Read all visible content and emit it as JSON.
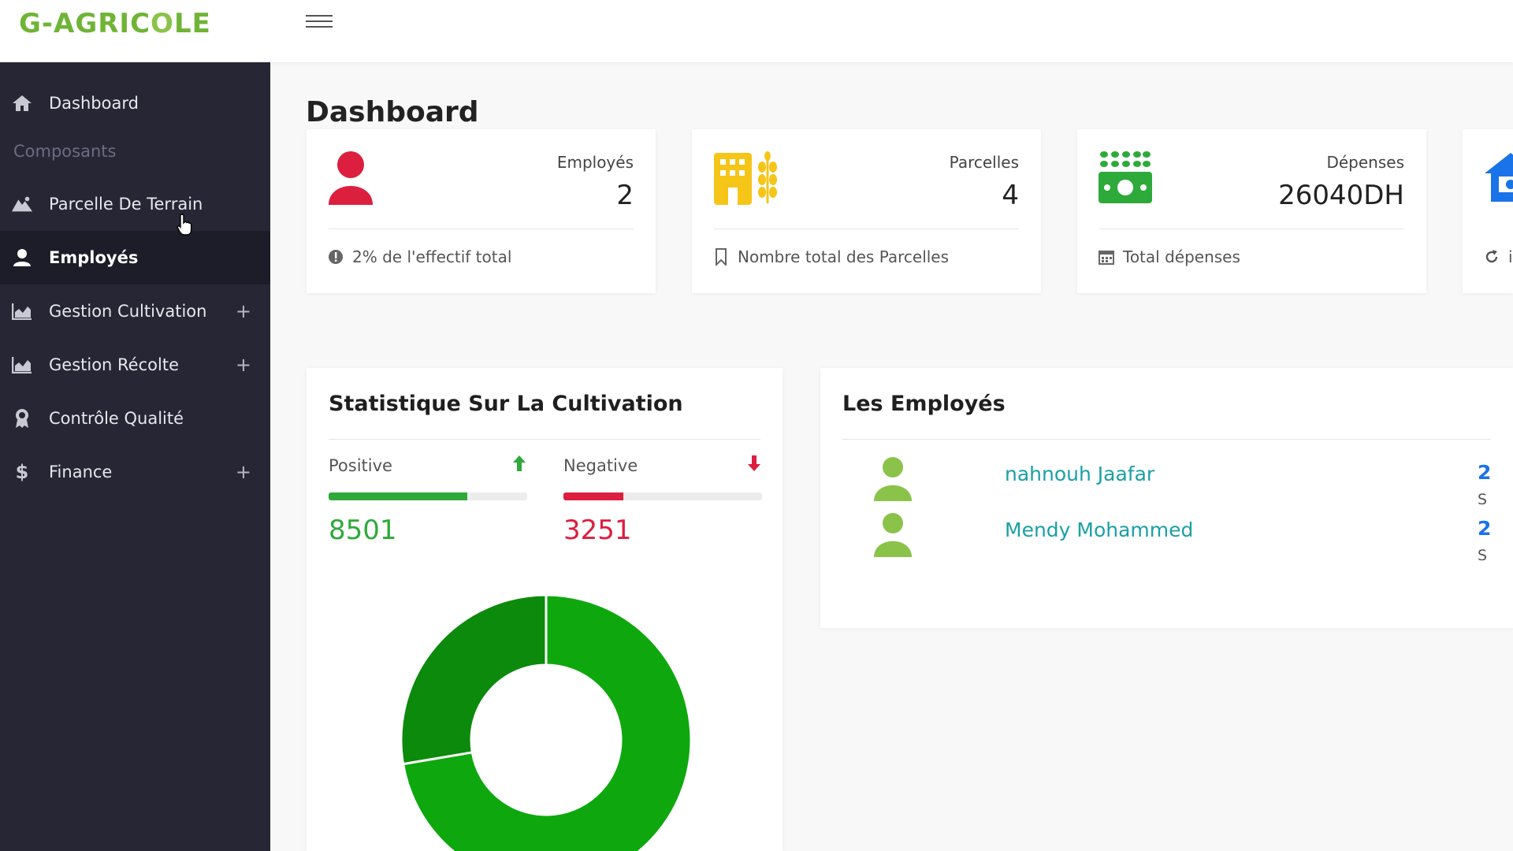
{
  "app": {
    "logo": "G-AGRICOLE",
    "logo_prefix": "G-AGRIC",
    "logo_leaf": "O",
    "logo_suffix": "LE"
  },
  "sidebar": {
    "section_label": "Composants",
    "items": [
      {
        "label": "Dashboard",
        "icon": "home-icon"
      },
      {
        "label": "Parcelle De Terrain",
        "icon": "mountain-icon"
      },
      {
        "label": "Employés",
        "icon": "user-icon",
        "active": true
      },
      {
        "label": "Gestion Cultivation",
        "icon": "chart-area-icon",
        "expandable": "+"
      },
      {
        "label": "Gestion Récolte",
        "icon": "chart-area-icon",
        "expandable": "+"
      },
      {
        "label": "Contrôle Qualité",
        "icon": "award-icon"
      },
      {
        "label": "Finance",
        "icon": "dollar-icon",
        "expandable": "+"
      }
    ]
  },
  "main": {
    "title": "Dashboard",
    "stats": [
      {
        "label": "Employés",
        "value": "2",
        "footer": "2% de l'effectif total",
        "icon": "user-icon",
        "footer_icon": "info-circle-icon",
        "color": "#dc1f3f"
      },
      {
        "label": "Parcelles",
        "value": "4",
        "footer": "Nombre total des Parcelles",
        "icon": "building-wheat-icon",
        "footer_icon": "bookmark-icon",
        "color": "#f5c518"
      },
      {
        "label": "Dépenses",
        "value": "26040DH",
        "footer": "Total dépenses",
        "icon": "money-bill-wheat-icon",
        "footer_icon": "calendar-icon",
        "color": "#2eaa3a"
      },
      {
        "label": "",
        "value": "",
        "footer": "i",
        "icon": "house-icon",
        "footer_icon": "redo-icon",
        "color": "#1a73e8"
      }
    ],
    "cultivation": {
      "title": "Statistique Sur La Cultivation",
      "positive": {
        "label": "Positive",
        "value": "8501",
        "color": "#2eaa3a",
        "bar_fraction": 0.7
      },
      "negative": {
        "label": "Negative",
        "value": "3251",
        "color": "#dc1f3f",
        "bar_fraction": 0.3
      }
    },
    "employees": {
      "title": "Les Employés",
      "list": [
        {
          "name": "nahnouh Jaafar",
          "extra": "2",
          "extra2": "S"
        },
        {
          "name": "Mendy Mohammed",
          "extra": "2",
          "extra2": "S"
        }
      ]
    }
  },
  "chart_data": {
    "type": "pie",
    "categories": [
      "Positive",
      "Negative"
    ],
    "values": [
      8501,
      3251
    ],
    "colors": [
      "#0ea80e",
      "#0b8a0b"
    ],
    "title": "",
    "donut": true
  }
}
